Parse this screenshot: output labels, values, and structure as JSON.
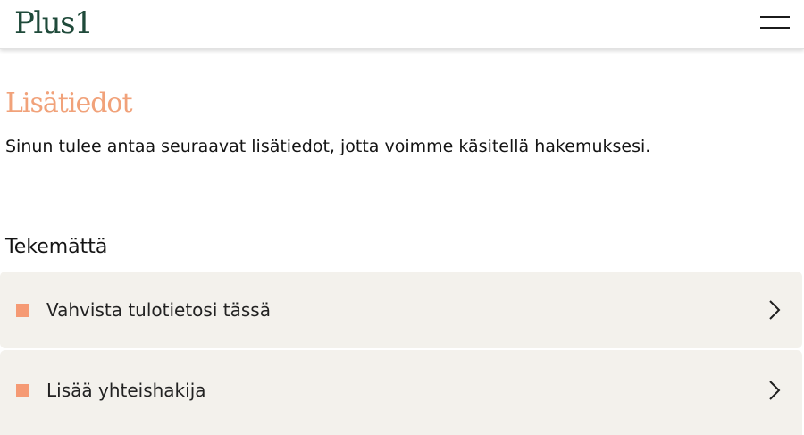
{
  "header": {
    "logo_text": "Plus1",
    "menu_icon": "hamburger-menu-icon"
  },
  "page": {
    "title": "Lisätiedot",
    "intro": "Sinun tulee antaa seuraavat lisätiedot, jotta voimme käsitellä hakemuksesi."
  },
  "tasks": {
    "section_title": "Tekemättä",
    "status_color": "#f59a74",
    "items": [
      {
        "label": "Vahvista tulotietosi tässä",
        "icon": "chevron-right-icon"
      },
      {
        "label": "Lisää yhteishakija",
        "icon": "chevron-right-icon"
      }
    ]
  },
  "colors": {
    "brand_green": "#1f4a3a",
    "title_orange": "#f1a27a",
    "card_bg": "#f3f1ec"
  }
}
